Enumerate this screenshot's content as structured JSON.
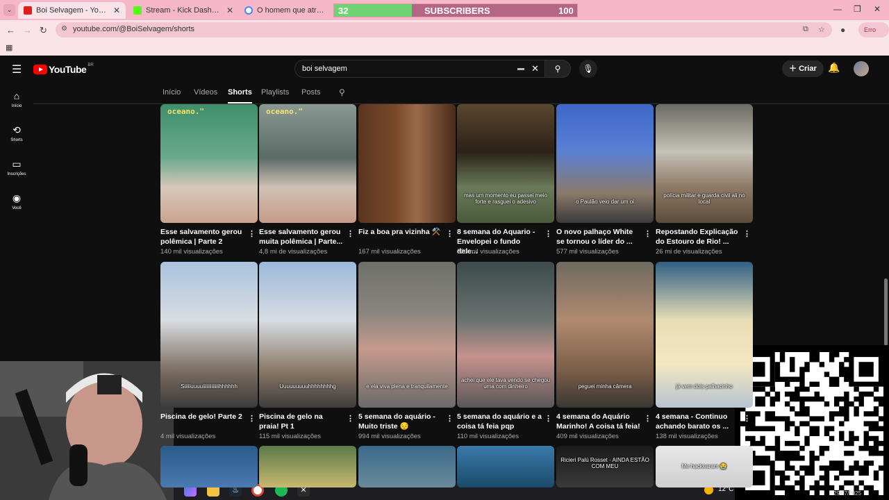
{
  "browser": {
    "tabs": [
      {
        "title": "Boi Selvagem - YouTube",
        "active": true,
        "icon": "youtube-icon"
      },
      {
        "title": "Stream - Kick Dashboard",
        "active": false,
        "icon": "kick-icon"
      },
      {
        "title": "O homem que atravessou o m",
        "active": false,
        "icon": "google-icon"
      }
    ],
    "url": "youtube.com/@BoiSelvagem/shorts",
    "error_label": "Erro"
  },
  "subscriber_goal": {
    "current": "32",
    "label": "SUBSCRIBERS",
    "goal": "100",
    "progress": 0.32
  },
  "youtube": {
    "logo_text": "YouTube",
    "logo_region": "BR",
    "search_query": "boi selvagem",
    "create_label": "Criar",
    "guide": [
      {
        "label": "Início",
        "icon": "home-icon"
      },
      {
        "label": "Shorts",
        "icon": "shorts-icon"
      },
      {
        "label": "Inscrições",
        "icon": "subscriptions-icon"
      },
      {
        "label": "Você",
        "icon": "you-icon"
      }
    ],
    "channel_tabs": [
      "Início",
      "Vídeos",
      "Shorts",
      "Playlists",
      "Posts"
    ],
    "selected_tab": "Shorts"
  },
  "shorts_row1": [
    {
      "title": "Esse salvamento gerou polêmica | Parte 2",
      "views": "140 mil visualizações",
      "overlay_top": "oceano.\"",
      "overlay_bottom": ""
    },
    {
      "title": "Esse salvamento gerou muita polêmica | Parte...",
      "views": "4,8 mi de visualizações",
      "overlay_top": "oceano.\"",
      "overlay_bottom": ""
    },
    {
      "title": "Fiz a boa pra vizinha ⚒️",
      "views": "167 mil visualizações",
      "overlay_top": "",
      "overlay_bottom": ""
    },
    {
      "title": "8 semana do Aquario - Envelopei o fundo dele...",
      "views": "323 mil visualizações",
      "overlay_top": "",
      "overlay_bottom": "mas um momento eu passei meio forte e rasguei o adesivo"
    },
    {
      "title": "O novo palhaço White se tornou o líder do ...",
      "views": "577 mil visualizações",
      "overlay_top": "",
      "overlay_bottom": "o Paulão veio dar um oi"
    },
    {
      "title": "Repostando Explicação do Estouro de Rio! ...",
      "views": "26 mi de visualizações",
      "overlay_top": "",
      "overlay_bottom": "polícia militar e guarda civil ali no local"
    }
  ],
  "shorts_row2": [
    {
      "title": "Piscina de gelo! Parte 2",
      "views": "4 mil visualizações",
      "overlay_bottom": "Siiiiiuuuuiiiiiiiiiiiiihhhhhh"
    },
    {
      "title": "Piscina de gelo na praia! Pt 1",
      "views": "115 mil visualizações",
      "overlay_bottom": "Uuuuuuuuuhhhhhhhhg"
    },
    {
      "title": "5 semana do aquário - Muito triste 😔",
      "views": "994 mil visualizações",
      "overlay_bottom": "e ela viva plena e tranquilamente"
    },
    {
      "title": "5 semana do aquário e a coisa tá feia pqp",
      "views": "110 mil visualizações",
      "overlay_bottom": "achei que ele tava vendo se chegou uma com dinheiro"
    },
    {
      "title": "4 semana do Aquário Marinho! A coisa tá feia!",
      "views": "409 mil visualizações",
      "overlay_bottom": "peguei minha câmera"
    },
    {
      "title": "4 semana - Continuo achando barato os ...",
      "views": "138 mil visualizações",
      "overlay_bottom": "já vem dois palhacinho"
    }
  ],
  "shorts_row3_overlays": [
    "",
    "",
    "",
    "",
    "Ricieri Palú Rosset · AINDA ESTÃO COM MEU",
    "Me hackearam 😭"
  ],
  "taskbar": {
    "temperature": "12°C",
    "date": "29/07/2025"
  },
  "colors": {
    "tabbar": "#f6b8c9",
    "progress_fill": "#6fd273",
    "progress_bg": "#b46684",
    "yt_red": "#ff0000",
    "bg": "#0f0f0f"
  }
}
